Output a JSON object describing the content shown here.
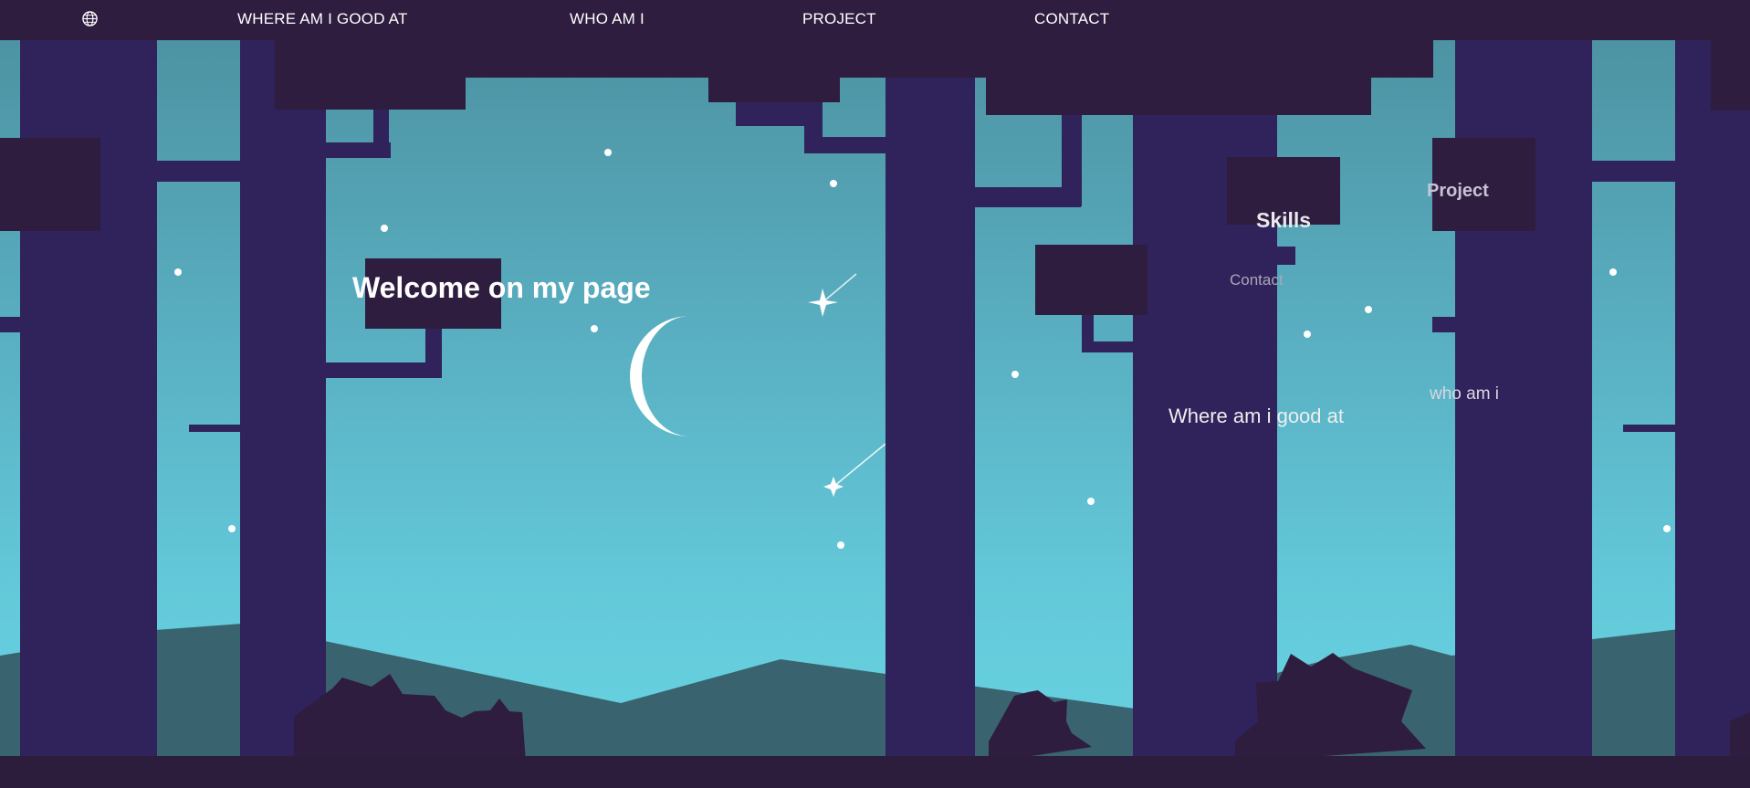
{
  "nav": {
    "globe_icon": "globe-icon",
    "items": [
      {
        "label": "WHERE AM I GOOD AT"
      },
      {
        "label": "WHO AM I"
      },
      {
        "label": "PROJECT"
      },
      {
        "label": "CONTACT"
      }
    ]
  },
  "hero": {
    "title": "Welcome on my page"
  },
  "scene_links": {
    "skills": "Skills",
    "project": "Project",
    "contact": "Contact",
    "who_am_i": "who am i",
    "where_good_at": "Where am i good at"
  },
  "colors": {
    "nav_bg": "#2e1d3f",
    "trunk": "#30225a",
    "sky_top": "#4b8f9f",
    "sky_bottom": "#68d4e1",
    "mountains": "#3a6370",
    "ground": "#2c1d3d"
  }
}
